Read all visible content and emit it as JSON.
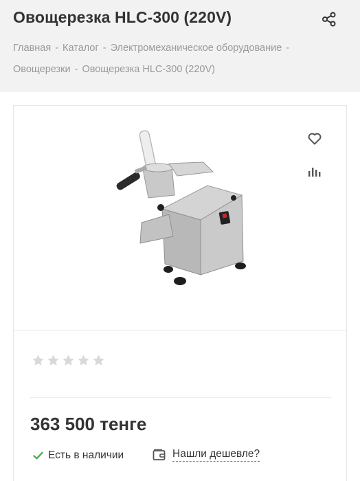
{
  "header": {
    "title": "Овощерезка HLC-300 (220V)",
    "share_icon": "share-icon",
    "breadcrumb": [
      "Главная",
      "Каталог",
      "Электромеханическое оборудование",
      "Овощерезки",
      "Овощерезка HLC-300 (220V)"
    ],
    "breadcrumb_separator": "-"
  },
  "product": {
    "image_icon": "vegetable-cutter-image",
    "favorite_icon": "heart-icon",
    "compare_icon": "compare-chart-icon",
    "rating": {
      "value": 0,
      "max": 5
    },
    "price": "363 500 тенге",
    "stock_label": "Есть в наличии",
    "stock_icon": "checkmark-icon",
    "cheaper_label": "Нашли дешевле?",
    "cheaper_icon": "wallet-icon"
  },
  "colors": {
    "header_bg": "#f2f2f2",
    "text": "#333333",
    "muted": "#999999",
    "star_empty": "#d9d9d9",
    "check": "#4caf50"
  }
}
